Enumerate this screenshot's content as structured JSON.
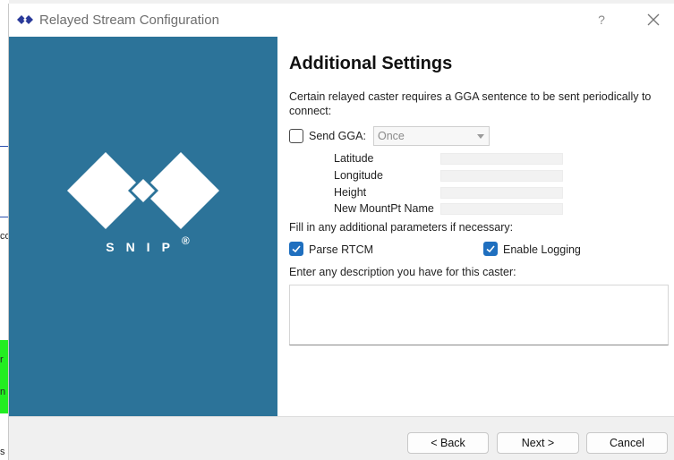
{
  "window": {
    "title": "Relayed Stream Configuration",
    "help_glyph": "?",
    "close_icon": "close-icon"
  },
  "brand": {
    "logo_text": "SNIP",
    "registered": "®",
    "banner_color": "#2c7399"
  },
  "page": {
    "heading": "Additional Settings",
    "gga_description": "Certain relayed caster requires a GGA sentence to be sent periodically to connect:",
    "send_gga": {
      "label": "Send GGA:",
      "checked": false
    },
    "gga_frequency": {
      "selected": "Once"
    },
    "fields": [
      {
        "label": "Latitude",
        "value": ""
      },
      {
        "label": "Longitude",
        "value": ""
      },
      {
        "label": "Height",
        "value": ""
      },
      {
        "label": "New MountPt Name",
        "value": ""
      }
    ],
    "params_description": "Fill in any additional parameters if necessary:",
    "parse_rtcm": {
      "label": "Parse RTCM",
      "checked": true
    },
    "enable_logging": {
      "label": "Enable Logging",
      "checked": true
    },
    "caster_description_prompt": "Enter any description you have for this caster:",
    "caster_description_value": ""
  },
  "footer": {
    "back": "< Back",
    "next": "Next >",
    "cancel": "Cancel"
  },
  "background": {
    "snippets": [
      "co",
      "r",
      "n",
      "s s"
    ]
  },
  "colors": {
    "accent": "#1f6fbf",
    "banner": "#2c7399"
  }
}
